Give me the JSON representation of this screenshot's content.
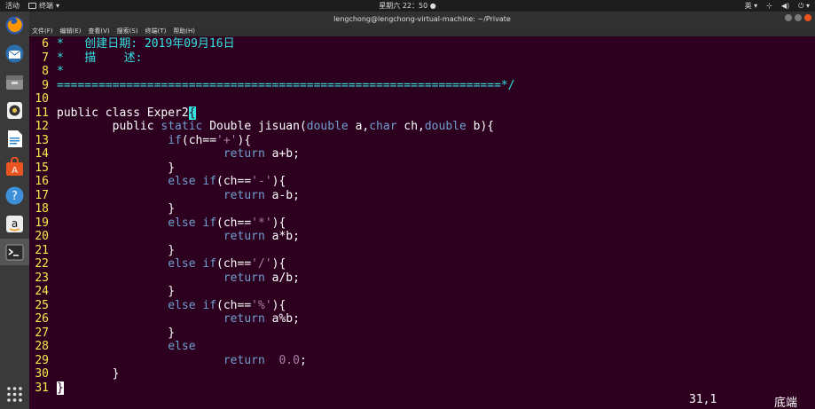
{
  "top_bar": {
    "activities": "活动",
    "app_name": "终端",
    "clock": "星期六 22：50",
    "lang": "英"
  },
  "title_bar": {
    "title": "lengchong@lengchong-virtual-machine: ~/Private"
  },
  "menu": [
    "文件(F)",
    "编辑(E)",
    "查看(V)",
    "搜索(S)",
    "终端(T)",
    "帮助(H)"
  ],
  "dock": [
    {
      "name": "firefox-icon",
      "color": "#e66000"
    },
    {
      "name": "thunderbird-icon",
      "color": "#2a6fb0"
    },
    {
      "name": "files-icon",
      "color": "#8f8f8f"
    },
    {
      "name": "rhythmbox-icon",
      "color": "#e8c54a"
    },
    {
      "name": "libreoffice-writer-icon",
      "color": "#2b86d0"
    },
    {
      "name": "software-center-icon",
      "color": "#e95420"
    },
    {
      "name": "help-icon",
      "color": "#3d8fd8"
    },
    {
      "name": "amazon-icon",
      "color": "#dcdcdc"
    },
    {
      "name": "terminal-icon",
      "color": "#2c2c2c"
    },
    {
      "name": "show-apps-icon",
      "color": "transparent"
    }
  ],
  "colors": {
    "background": "#2c001e",
    "line_number": "#fce94f",
    "comment": "#34e2e2",
    "keyword_type": "#729fcf",
    "string": "#ad7fa8"
  },
  "code": [
    {
      "n": "6",
      "parts": [
        {
          "t": "*   创建日期: 2019年09月16日",
          "c": "c-cyan"
        }
      ]
    },
    {
      "n": "7",
      "parts": [
        {
          "t": "*   描    述:",
          "c": "c-cyan"
        }
      ]
    },
    {
      "n": "8",
      "parts": [
        {
          "t": "*",
          "c": "c-cyan"
        }
      ]
    },
    {
      "n": "9",
      "parts": [
        {
          "t": "================================================================*/",
          "c": "c-cyan"
        }
      ]
    },
    {
      "n": "10",
      "parts": []
    },
    {
      "n": "11",
      "parts": [
        {
          "t": "public class Exper2",
          "c": ""
        },
        {
          "t": "{",
          "c": "c-cursor"
        }
      ]
    },
    {
      "n": "12",
      "parts": [
        {
          "t": "        public ",
          "c": ""
        },
        {
          "t": "static",
          "c": "c-blue"
        },
        {
          "t": " Double jisuan(",
          "c": ""
        },
        {
          "t": "double",
          "c": "c-blue"
        },
        {
          "t": " a,",
          "c": ""
        },
        {
          "t": "char",
          "c": "c-blue"
        },
        {
          "t": " ch,",
          "c": ""
        },
        {
          "t": "double",
          "c": "c-blue"
        },
        {
          "t": " b){",
          "c": ""
        }
      ]
    },
    {
      "n": "13",
      "parts": [
        {
          "t": "                ",
          "c": ""
        },
        {
          "t": "if",
          "c": "c-blue"
        },
        {
          "t": "(ch==",
          "c": ""
        },
        {
          "t": "'+'",
          "c": "c-magenta"
        },
        {
          "t": "){",
          "c": ""
        }
      ]
    },
    {
      "n": "14",
      "parts": [
        {
          "t": "                        ",
          "c": ""
        },
        {
          "t": "return",
          "c": "c-blue"
        },
        {
          "t": " a+b;",
          "c": ""
        }
      ]
    },
    {
      "n": "15",
      "parts": [
        {
          "t": "                }",
          "c": ""
        }
      ]
    },
    {
      "n": "16",
      "parts": [
        {
          "t": "                ",
          "c": ""
        },
        {
          "t": "else if",
          "c": "c-blue"
        },
        {
          "t": "(ch==",
          "c": ""
        },
        {
          "t": "'-'",
          "c": "c-magenta"
        },
        {
          "t": "){",
          "c": ""
        }
      ]
    },
    {
      "n": "17",
      "parts": [
        {
          "t": "                        ",
          "c": ""
        },
        {
          "t": "return",
          "c": "c-blue"
        },
        {
          "t": " a-b;",
          "c": ""
        }
      ]
    },
    {
      "n": "18",
      "parts": [
        {
          "t": "                }",
          "c": ""
        }
      ]
    },
    {
      "n": "19",
      "parts": [
        {
          "t": "                ",
          "c": ""
        },
        {
          "t": "else if",
          "c": "c-blue"
        },
        {
          "t": "(ch==",
          "c": ""
        },
        {
          "t": "'*'",
          "c": "c-magenta"
        },
        {
          "t": "){",
          "c": ""
        }
      ]
    },
    {
      "n": "20",
      "parts": [
        {
          "t": "                        ",
          "c": ""
        },
        {
          "t": "return",
          "c": "c-blue"
        },
        {
          "t": " a*b;",
          "c": ""
        }
      ]
    },
    {
      "n": "21",
      "parts": [
        {
          "t": "                }",
          "c": ""
        }
      ]
    },
    {
      "n": "22",
      "parts": [
        {
          "t": "                ",
          "c": ""
        },
        {
          "t": "else if",
          "c": "c-blue"
        },
        {
          "t": "(ch==",
          "c": ""
        },
        {
          "t": "'/'",
          "c": "c-magenta"
        },
        {
          "t": "){",
          "c": ""
        }
      ]
    },
    {
      "n": "23",
      "parts": [
        {
          "t": "                        ",
          "c": ""
        },
        {
          "t": "return",
          "c": "c-blue"
        },
        {
          "t": " a/b;",
          "c": ""
        }
      ]
    },
    {
      "n": "24",
      "parts": [
        {
          "t": "                }",
          "c": ""
        }
      ]
    },
    {
      "n": "25",
      "parts": [
        {
          "t": "                ",
          "c": ""
        },
        {
          "t": "else if",
          "c": "c-blue"
        },
        {
          "t": "(ch==",
          "c": ""
        },
        {
          "t": "'%'",
          "c": "c-magenta"
        },
        {
          "t": "){",
          "c": ""
        }
      ]
    },
    {
      "n": "26",
      "parts": [
        {
          "t": "                        ",
          "c": ""
        },
        {
          "t": "return",
          "c": "c-blue"
        },
        {
          "t": " a%b;",
          "c": ""
        }
      ]
    },
    {
      "n": "27",
      "parts": [
        {
          "t": "                }",
          "c": ""
        }
      ]
    },
    {
      "n": "28",
      "parts": [
        {
          "t": "                ",
          "c": ""
        },
        {
          "t": "else",
          "c": "c-blue"
        }
      ]
    },
    {
      "n": "29",
      "parts": [
        {
          "t": "                        ",
          "c": ""
        },
        {
          "t": "return",
          "c": "c-blue"
        },
        {
          "t": "  ",
          "c": ""
        },
        {
          "t": "0.0",
          "c": "c-magenta"
        },
        {
          "t": ";",
          "c": ""
        }
      ]
    },
    {
      "n": "30",
      "parts": [
        {
          "t": "        }",
          "c": ""
        }
      ]
    },
    {
      "n": "31",
      "parts": [
        {
          "t": "}",
          "c": "c-cursor-w"
        }
      ]
    }
  ],
  "status": {
    "position": "31,1",
    "scroll": "底端"
  }
}
